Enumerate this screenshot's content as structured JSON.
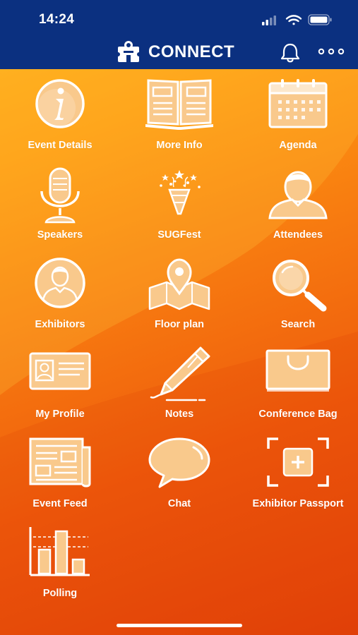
{
  "status_bar": {
    "time": "14:24"
  },
  "header": {
    "app_name": "CONNECT"
  },
  "icons": {
    "logo": "puzzle-person-logo-icon",
    "notifications": "bell-icon",
    "more": "more-dots-icon"
  },
  "colors": {
    "header": "#0b3080",
    "background_top": "#ffb21a",
    "background_bottom": "#e2430a",
    "icon_fill": "#f9c98c",
    "text": "#ffffff"
  },
  "tiles": [
    {
      "label": "Event Details",
      "icon": "info-icon"
    },
    {
      "label": "More Info",
      "icon": "book-icon"
    },
    {
      "label": "Agenda",
      "icon": "calendar-icon"
    },
    {
      "label": "Speakers",
      "icon": "microphone-icon"
    },
    {
      "label": "SUGFest",
      "icon": "party-popper-icon"
    },
    {
      "label": "Attendees",
      "icon": "person-icon"
    },
    {
      "label": "Exhibitors",
      "icon": "person-circle-icon"
    },
    {
      "label": "Floor plan",
      "icon": "map-pin-icon"
    },
    {
      "label": "Search",
      "icon": "magnifier-icon"
    },
    {
      "label": "My Profile",
      "icon": "id-card-icon"
    },
    {
      "label": "Notes",
      "icon": "pen-icon"
    },
    {
      "label": "Conference Bag",
      "icon": "bag-icon"
    },
    {
      "label": "Event Feed",
      "icon": "newspaper-icon"
    },
    {
      "label": "Chat",
      "icon": "speech-bubble-icon"
    },
    {
      "label": "Exhibitor Passport",
      "icon": "passport-scan-icon"
    },
    {
      "label": "Polling",
      "icon": "bar-chart-icon"
    }
  ]
}
